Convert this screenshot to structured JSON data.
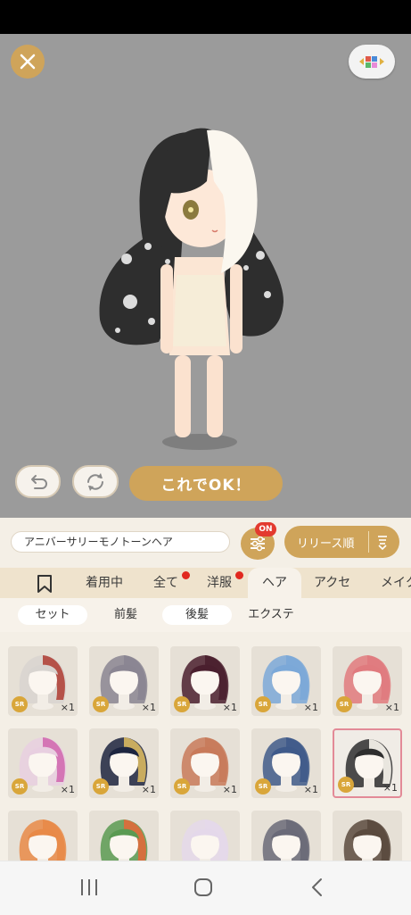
{
  "character": {
    "hair_colors": [
      "#2e2e2e",
      "#fbf7ef"
    ]
  },
  "buttons": {
    "ok_label": "これでOK！"
  },
  "filter": {
    "search_value": "アニバーサリーモノトーンヘア",
    "toggle_badge": "ON",
    "sort_label": "リリース順"
  },
  "tabs": [
    {
      "label": "着用中"
    },
    {
      "label": "全て"
    },
    {
      "label": "洋服"
    },
    {
      "label": "ヘア"
    },
    {
      "label": "アクセ"
    },
    {
      "label": "メイク"
    }
  ],
  "subtabs": [
    {
      "label": "セット"
    },
    {
      "label": "前髪"
    },
    {
      "label": "後髪"
    },
    {
      "label": "エクステ"
    }
  ],
  "items": [
    {
      "rarity": "SR",
      "qty": "×1",
      "color": "#d8d4d0",
      "accent": "#b0443a"
    },
    {
      "rarity": "SR",
      "qty": "×1",
      "color": "#8a8592",
      "accent": "#8a8592"
    },
    {
      "rarity": "SR",
      "qty": "×1",
      "color": "#4a1f2e",
      "accent": "#4a1f2e"
    },
    {
      "rarity": "SR",
      "qty": "×1",
      "color": "#7ba8d8",
      "accent": "#7ba8d8"
    },
    {
      "rarity": "SR",
      "qty": "×1",
      "color": "#e07a7e",
      "accent": "#e07a7e"
    },
    {
      "rarity": "SR",
      "qty": "×1",
      "color": "#e8cfe0",
      "accent": "#d26ab0"
    },
    {
      "rarity": "SR",
      "qty": "×1",
      "color": "#1d2540",
      "accent": "#d8b860"
    },
    {
      "rarity": "SR",
      "qty": "×1",
      "color": "#c87a5a",
      "accent": "#c87a5a"
    },
    {
      "rarity": "SR",
      "qty": "×1",
      "color": "#3f5a8a",
      "accent": "#3f5a8a"
    },
    {
      "rarity": "SR",
      "qty": "×1",
      "color": "#2e2e2e",
      "accent": "#fbf7ef"
    },
    {
      "rarity": "",
      "qty": "",
      "color": "#e88a48",
      "accent": "#e88a48"
    },
    {
      "rarity": "",
      "qty": "",
      "color": "#5a9a52",
      "accent": "#e06a3a"
    },
    {
      "rarity": "",
      "qty": "",
      "color": "#e4d8ea",
      "accent": "#e4d8ea"
    },
    {
      "rarity": "",
      "qty": "",
      "color": "#6a6a78",
      "accent": "#6a6a78"
    },
    {
      "rarity": "",
      "qty": "",
      "color": "#5a4a3e",
      "accent": "#5a4a3e"
    }
  ]
}
